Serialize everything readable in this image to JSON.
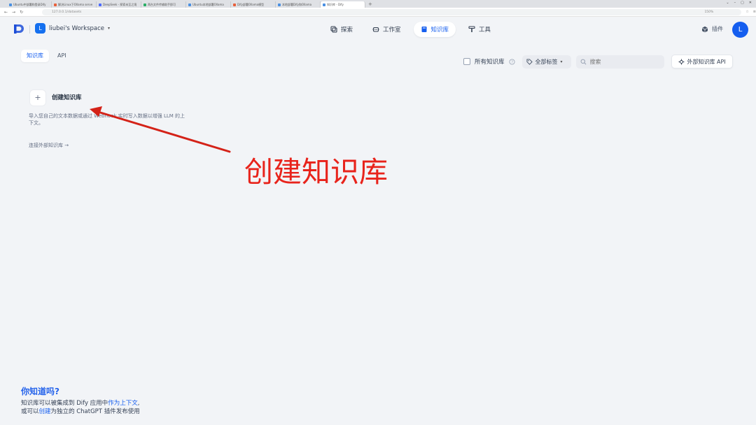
{
  "browser": {
    "tabs": [
      {
        "label": "Ubuntu中部署和登录Dify"
      },
      {
        "label": "解决Linux下Ollama serve"
      },
      {
        "label": "DeepSeek - 探索未至之境"
      },
      {
        "label": "两台文件传输助手即可"
      },
      {
        "label": "Ubuntu本地部署Ollama"
      },
      {
        "label": "Dify部署Ollama模型"
      },
      {
        "label": "本地部署Dify和Ollama"
      },
      {
        "label": "知识库 - Dify"
      }
    ],
    "new_tab": "+",
    "window_controls": [
      "⌄",
      "–",
      "▢",
      "✕"
    ],
    "nav": {
      "back": "←",
      "forward": "→",
      "reload": "↻"
    },
    "url": "127.0.0.1/datasets",
    "zoom": "150%"
  },
  "header": {
    "workspace": {
      "avatar": "L",
      "name": "liubei's Workspace"
    },
    "nav": [
      {
        "label": "探索"
      },
      {
        "label": "工作室"
      },
      {
        "label": "知识库"
      },
      {
        "label": "工具"
      }
    ],
    "plugins": "插件",
    "user_avatar": "L"
  },
  "subtabs": [
    {
      "label": "知识库"
    },
    {
      "label": "API"
    }
  ],
  "filters": {
    "all_kb_label": "所有知识库",
    "tags_label": "全部标签",
    "search_placeholder": "搜索",
    "external_api": "外部知识库 API"
  },
  "create_card": {
    "plus": "+",
    "title": "创建知识库",
    "description": "导入您自己的文本数据或通过 Webhook 实时写入数据以增强 LLM 的上下文。",
    "connect_external": "连接外部知识库 →"
  },
  "annotation": {
    "text": "创建知识库",
    "color": "#e8231b"
  },
  "tip": {
    "title": "你知道吗?",
    "line1_a": "知识库可以被集成到 Dify 应用中",
    "line1_link": "作为上下文",
    "line1_b": ",",
    "line2_a": "或可以",
    "line2_link": "创建",
    "line2_b": "为独立的 ChatGPT 插件发布使用"
  },
  "colors": {
    "accent": "#155eef",
    "background": "#f2f4f7"
  }
}
